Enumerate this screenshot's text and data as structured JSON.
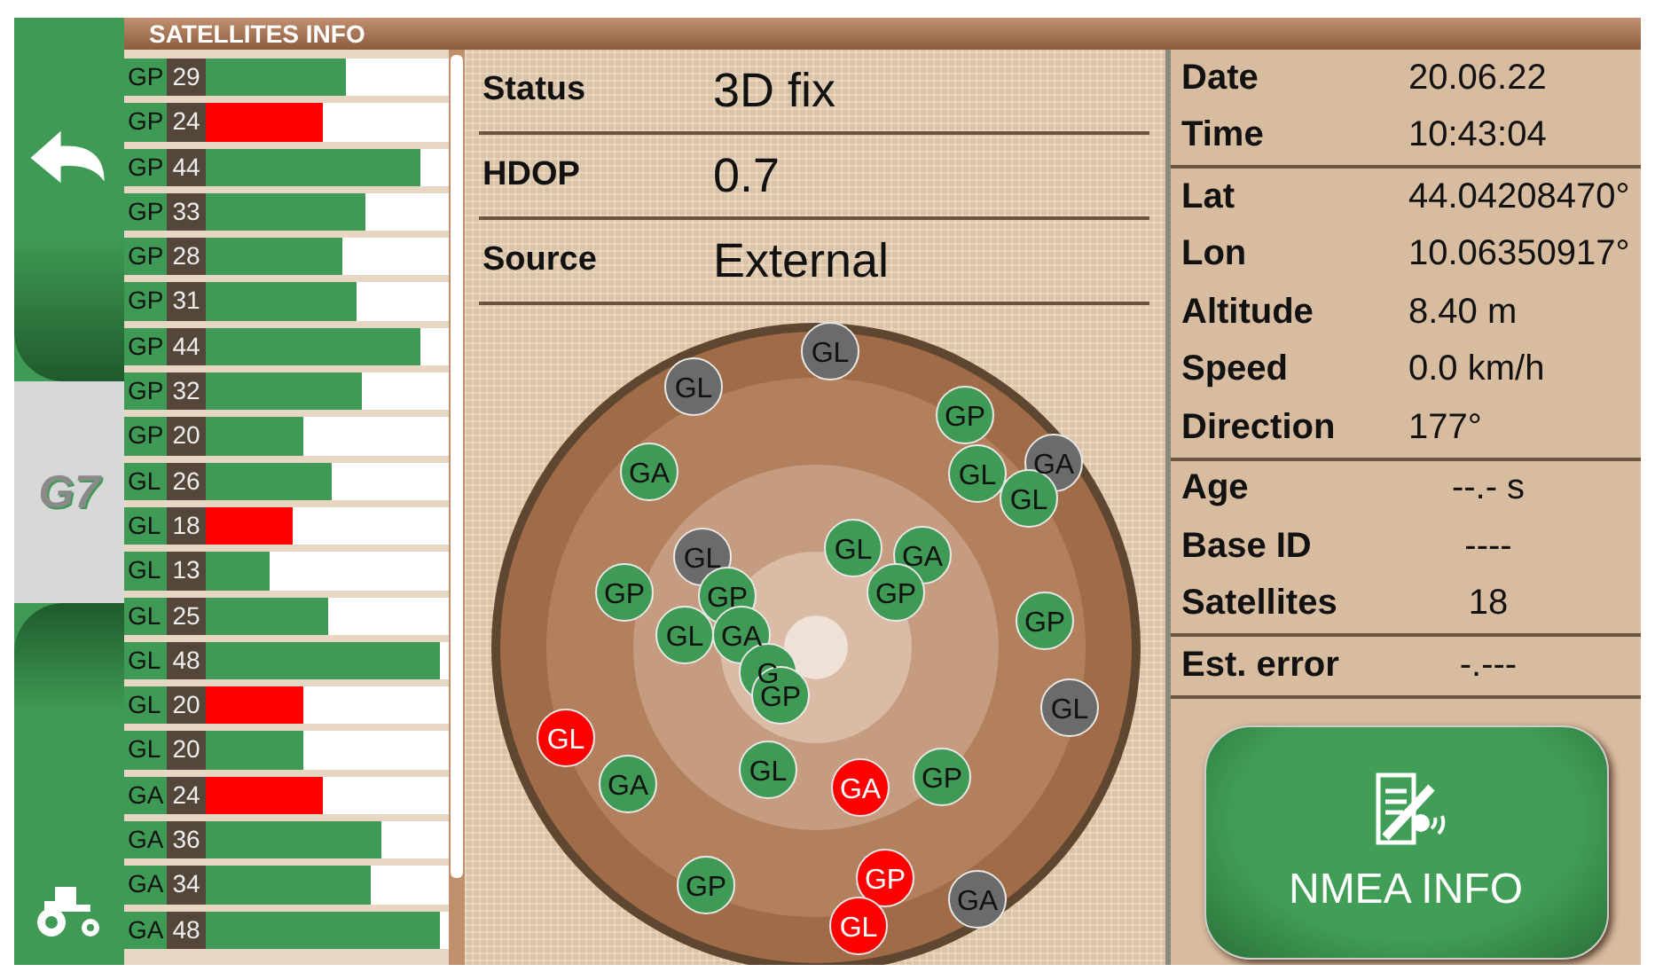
{
  "header": {
    "title": "SATELLITES INFO"
  },
  "sidebar": {
    "logo": "G7"
  },
  "satellite_bars": [
    {
      "system": "GP",
      "snr": "29",
      "level": 0.58,
      "color": "#3f9a55"
    },
    {
      "system": "GP",
      "snr": "24",
      "level": 0.48,
      "color": "#ff0000"
    },
    {
      "system": "GP",
      "snr": "44",
      "level": 0.88,
      "color": "#3f9a55"
    },
    {
      "system": "GP",
      "snr": "33",
      "level": 0.66,
      "color": "#3f9a55"
    },
    {
      "system": "GP",
      "snr": "28",
      "level": 0.56,
      "color": "#3f9a55"
    },
    {
      "system": "GP",
      "snr": "31",
      "level": 0.62,
      "color": "#3f9a55"
    },
    {
      "system": "GP",
      "snr": "44",
      "level": 0.88,
      "color": "#3f9a55"
    },
    {
      "system": "GP",
      "snr": "32",
      "level": 0.64,
      "color": "#3f9a55"
    },
    {
      "system": "GP",
      "snr": "20",
      "level": 0.4,
      "color": "#3f9a55"
    },
    {
      "system": "GL",
      "snr": "26",
      "level": 0.52,
      "color": "#3f9a55"
    },
    {
      "system": "GL",
      "snr": "18",
      "level": 0.36,
      "color": "#ff0000"
    },
    {
      "system": "GL",
      "snr": "13",
      "level": 0.26,
      "color": "#3f9a55"
    },
    {
      "system": "GL",
      "snr": "25",
      "level": 0.5,
      "color": "#3f9a55"
    },
    {
      "system": "GL",
      "snr": "48",
      "level": 0.96,
      "color": "#3f9a55"
    },
    {
      "system": "GL",
      "snr": "20",
      "level": 0.4,
      "color": "#ff0000"
    },
    {
      "system": "GL",
      "snr": "20",
      "level": 0.4,
      "color": "#3f9a55"
    },
    {
      "system": "GA",
      "snr": "24",
      "level": 0.48,
      "color": "#ff0000"
    },
    {
      "system": "GA",
      "snr": "36",
      "level": 0.72,
      "color": "#3f9a55"
    },
    {
      "system": "GA",
      "snr": "34",
      "level": 0.68,
      "color": "#3f9a55"
    },
    {
      "system": "GA",
      "snr": "48",
      "level": 0.96,
      "color": "#3f9a55"
    }
  ],
  "fix_info": [
    {
      "label": "Status",
      "value": "3D fix"
    },
    {
      "label": "HDOP",
      "value": "0.7"
    },
    {
      "label": "Source",
      "value": "External"
    }
  ],
  "sky_plot": {
    "satellites": [
      {
        "label": "GL",
        "color": "#6b6b6b"
      },
      {
        "label": "GL",
        "color": "#6b6b6b"
      },
      {
        "label": "GP",
        "color": "#3f9a55"
      },
      {
        "label": "GA",
        "color": "#3f9a55"
      },
      {
        "label": "GL",
        "color": "#3f9a55"
      },
      {
        "label": "GL",
        "color": "#3f9a55"
      },
      {
        "label": "GA",
        "color": "#6b6b6b"
      },
      {
        "label": "GL",
        "color": "#6b6b6b"
      },
      {
        "label": "GL",
        "color": "#3f9a55"
      },
      {
        "label": "GA",
        "color": "#3f9a55"
      },
      {
        "label": "GP",
        "color": "#3f9a55"
      },
      {
        "label": "GP",
        "color": "#3f9a55"
      },
      {
        "label": "GP",
        "color": "#3f9a55"
      },
      {
        "label": "GP",
        "color": "#3f9a55"
      },
      {
        "label": "GL",
        "color": "#3f9a55"
      },
      {
        "label": "GA",
        "color": "#3f9a55"
      },
      {
        "label": "G",
        "color": "#3f9a55"
      },
      {
        "label": "GP",
        "color": "#3f9a55"
      },
      {
        "label": "GL",
        "color": "#6b6b6b"
      },
      {
        "label": "GL",
        "color": "#ff0000"
      },
      {
        "label": "GA",
        "color": "#3f9a55"
      },
      {
        "label": "GL",
        "color": "#3f9a55"
      },
      {
        "label": "GA",
        "color": "#ff0000"
      },
      {
        "label": "GP",
        "color": "#3f9a55"
      },
      {
        "label": "GP",
        "color": "#3f9a55"
      },
      {
        "label": "GP",
        "color": "#ff0000"
      },
      {
        "label": "GA",
        "color": "#6b6b6b"
      },
      {
        "label": "GL",
        "color": "#ff0000"
      }
    ]
  },
  "position_info": [
    {
      "kind": "left",
      "rows": [
        {
          "label": "Date",
          "value": "20.06.22"
        },
        {
          "label": "Time",
          "value": "10:43:04"
        }
      ]
    },
    {
      "kind": "left",
      "rows": [
        {
          "label": "Lat",
          "value": "44.04208470°"
        },
        {
          "label": "Lon",
          "value": "10.06350917°"
        },
        {
          "label": "Altitude",
          "value": "8.40 m"
        },
        {
          "label": "Speed",
          "value": "0.0 km/h"
        },
        {
          "label": "Direction",
          "value": "177°"
        }
      ]
    },
    {
      "kind": "center",
      "rows": [
        {
          "label": "Age",
          "value": "--.- s"
        },
        {
          "label": "Base ID",
          "value": "----"
        },
        {
          "label": "Satellites",
          "value": "18"
        }
      ]
    },
    {
      "kind": "center",
      "rows": [
        {
          "label": "Est. error",
          "value": "-.---"
        }
      ]
    }
  ],
  "nmea_button": {
    "label": "NMEA INFO"
  }
}
